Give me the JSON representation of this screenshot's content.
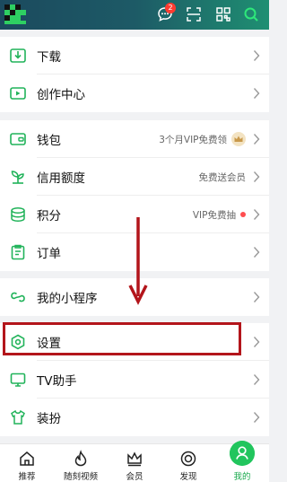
{
  "header": {
    "notification_count": "2",
    "icons": [
      "avatar-icon",
      "message-icon",
      "scan-icon",
      "qr-code-icon",
      "search-icon"
    ]
  },
  "menu": {
    "download": "下载",
    "creator_center": "创作中心",
    "wallet": "钱包",
    "wallet_tip": "3个月VIP免费领",
    "credit": "信用额度",
    "credit_tip": "免费送会员",
    "points": "积分",
    "points_tip": "VIP免费抽",
    "orders": "订单",
    "mini_programs": "我的小程序",
    "settings": "设置",
    "tv_assistant": "TV助手",
    "theme": "装扮"
  },
  "tabs": [
    {
      "label": "推荐",
      "icon": "home-icon"
    },
    {
      "label": "随刻视频",
      "icon": "flame-icon"
    },
    {
      "label": "会员",
      "icon": "crown-icon"
    },
    {
      "label": "发现",
      "icon": "discover-icon"
    },
    {
      "label": "我的",
      "icon": "profile-icon"
    }
  ],
  "colors": {
    "accent": "#21c55d",
    "highlight_box": "#b3151b",
    "arrow": "#b3151b"
  }
}
